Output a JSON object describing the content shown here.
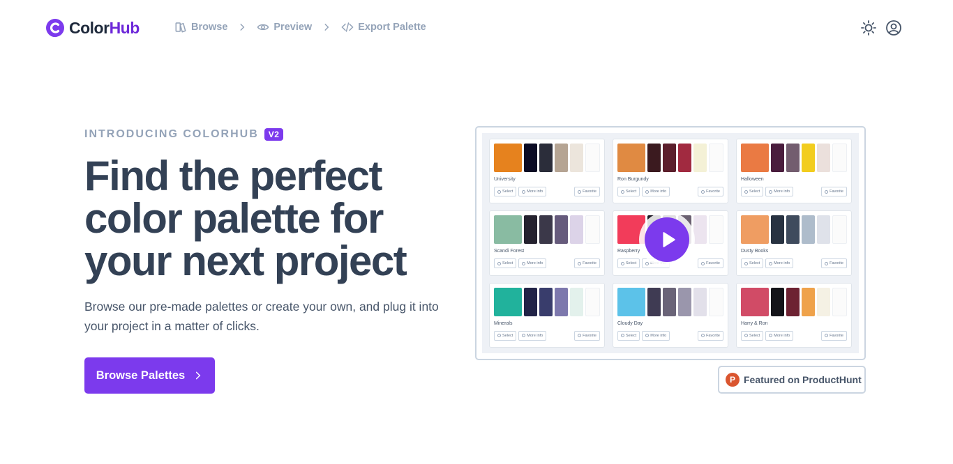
{
  "brand": {
    "name_part1": "Color",
    "name_part2": "Hub",
    "accent": "#7c3aed"
  },
  "nav": {
    "crumbs": [
      {
        "label": "Browse",
        "icon": "book-icon"
      },
      {
        "label": "Preview",
        "icon": "eye-icon"
      },
      {
        "label": "Export Palette",
        "icon": "code-icon"
      }
    ]
  },
  "header_actions": {
    "theme_icon": "sun-icon",
    "account_icon": "user-circle-icon"
  },
  "hero": {
    "eyebrow": "INTRODUCING COLORHUB",
    "badge": "V2",
    "headline": "Find the perfect color palette for your next project",
    "subtext": "Browse our pre-made palettes or create your own, and plug it into your project in a matter of clicks.",
    "cta_label": "Browse Palettes"
  },
  "preview": {
    "actions": {
      "select": "Select",
      "more_info": "More info",
      "favorite": "Favorite"
    },
    "palettes": [
      {
        "name": "University",
        "colors": [
          "#e6821e",
          "#0b0b24",
          "#2b2d3a",
          "#b5a493",
          "#ece5dc",
          "#fbfbfb"
        ]
      },
      {
        "name": "Ron Burgundy",
        "colors": [
          "#e08a42",
          "#3b1a1f",
          "#5c1f2c",
          "#a12a40",
          "#f4f1d6",
          "#fbfbfb"
        ]
      },
      {
        "name": "Halloween",
        "colors": [
          "#ea7a43",
          "#4a1d3d",
          "#735d6f",
          "#f2cd1e",
          "#ebe0dc",
          "#fbfbfb"
        ]
      },
      {
        "name": "Scandi Forest",
        "colors": [
          "#89bba2",
          "#25222f",
          "#3b3849",
          "#665b7c",
          "#dcd3e8",
          "#fbfbfb"
        ]
      },
      {
        "name": "Raspberry",
        "colors": [
          "#f23c5a",
          "#1f1a24",
          "#3a2d40",
          "#6a6070",
          "#ece4ef",
          "#fbfbfb"
        ]
      },
      {
        "name": "Dusty Books",
        "colors": [
          "#ef9d62",
          "#283241",
          "#3f4b5d",
          "#aebccb",
          "#dfe2ea",
          "#fbfbfb"
        ]
      },
      {
        "name": "Minerals",
        "colors": [
          "#21b29c",
          "#222447",
          "#393d6c",
          "#7d78ad",
          "#e3f1ec",
          "#fbfbfb"
        ]
      },
      {
        "name": "Cloudy Day",
        "colors": [
          "#5cc2e9",
          "#3f3b53",
          "#6a6478",
          "#9a96ac",
          "#e2e0ea",
          "#fbfbfb"
        ]
      },
      {
        "name": "Harry & Ron",
        "colors": [
          "#d14b66",
          "#141419",
          "#6d2232",
          "#efa24a",
          "#f5f1e4",
          "#fbfbfb"
        ]
      }
    ]
  },
  "producthunt": {
    "logo_letter": "P",
    "label": "Featured on ProductHunt"
  }
}
